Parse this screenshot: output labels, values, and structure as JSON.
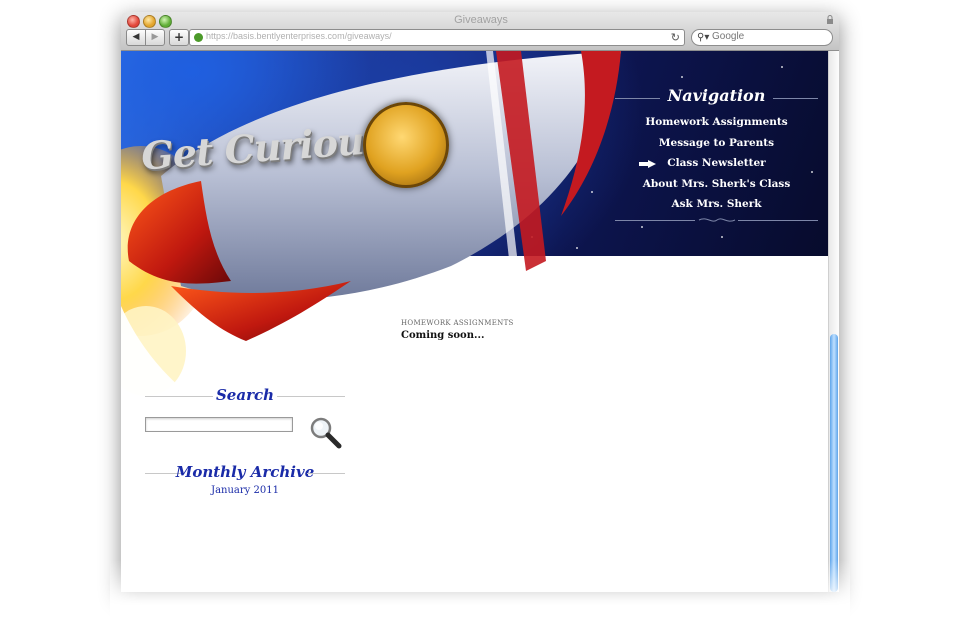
{
  "window": {
    "title": "Giveaways",
    "url": "https://basis.bentlyenterprises.com/giveaways/",
    "search_placeholder": "Google"
  },
  "header": {
    "logo_text": "Get Curious"
  },
  "navigation": {
    "title": "Navigation",
    "items": [
      {
        "label": "Homework Assignments"
      },
      {
        "label": "Message to Parents"
      },
      {
        "label": "Class Newsletter"
      },
      {
        "label": "About Mrs. Sherk's Class"
      },
      {
        "label": "Ask Mrs. Sherk"
      }
    ]
  },
  "main": {
    "section_label": "HOMEWORK ASSIGNMENTS",
    "body": "Coming soon..."
  },
  "sidebar": {
    "search_title": "Search",
    "archive_title": "Monthly Archive",
    "archive_items": [
      {
        "label": "January 2011"
      }
    ]
  },
  "colors": {
    "heading_blue": "#1a2ba8",
    "nav_background": "#0a0f3a",
    "scrollbar_blue": "#5ea4ea"
  }
}
